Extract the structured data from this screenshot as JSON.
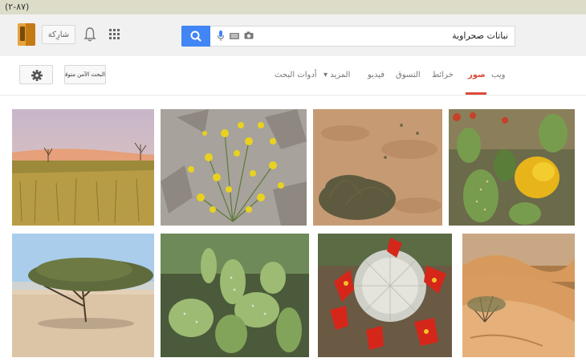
{
  "caption": "(٨٧-٢)",
  "header": {
    "share_label": "شارِكة",
    "search_value": "نباتات صحراوية"
  },
  "nav": {
    "tabs": [
      {
        "label": "ويب"
      },
      {
        "label": "صور"
      },
      {
        "label": "خرائط"
      },
      {
        "label": "التسوق"
      },
      {
        "label": "فيديو"
      },
      {
        "label": "المزيد ▾"
      },
      {
        "label": "أدوات البحث"
      }
    ],
    "safesearch_label": "البحث الآمن متوقف▾"
  },
  "images": [
    {
      "name": "desert-grassland"
    },
    {
      "name": "yellow-flowers"
    },
    {
      "name": "desert-shrub"
    },
    {
      "name": "prickly-pear-yellow-flower"
    },
    {
      "name": "acacia-tree"
    },
    {
      "name": "cactus-pads"
    },
    {
      "name": "cactus-red-flowers"
    },
    {
      "name": "sand-dunes-bush"
    }
  ]
}
